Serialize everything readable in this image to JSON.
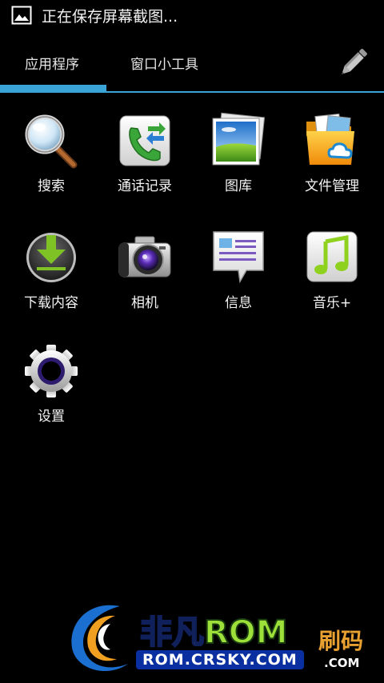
{
  "status_bar": {
    "notification_icon": "image-icon",
    "text": "正在保存屏幕截图..."
  },
  "tabs": {
    "apps_label": "应用程序",
    "widgets_label": "窗口小工具",
    "edit_icon": "pencil-icon",
    "accent_color": "#3aa4d6"
  },
  "apps": [
    {
      "label": "搜索",
      "icon": "search-icon"
    },
    {
      "label": "通话记录",
      "icon": "call-log-icon"
    },
    {
      "label": "图库",
      "icon": "gallery-icon"
    },
    {
      "label": "文件管理",
      "icon": "folder-icon"
    },
    {
      "label": "下载内容",
      "icon": "download-icon"
    },
    {
      "label": "相机",
      "icon": "camera-icon"
    },
    {
      "label": "信息",
      "icon": "messaging-icon"
    },
    {
      "label": "音乐+",
      "icon": "music-icon"
    },
    {
      "label": "设置",
      "icon": "settings-icon"
    }
  ],
  "watermark": {
    "brand_zh": "非凡",
    "brand_rom": "ROM",
    "site": "ROM.CRSKY.COM",
    "side_text": "刷码",
    "side_com": ".COM"
  }
}
